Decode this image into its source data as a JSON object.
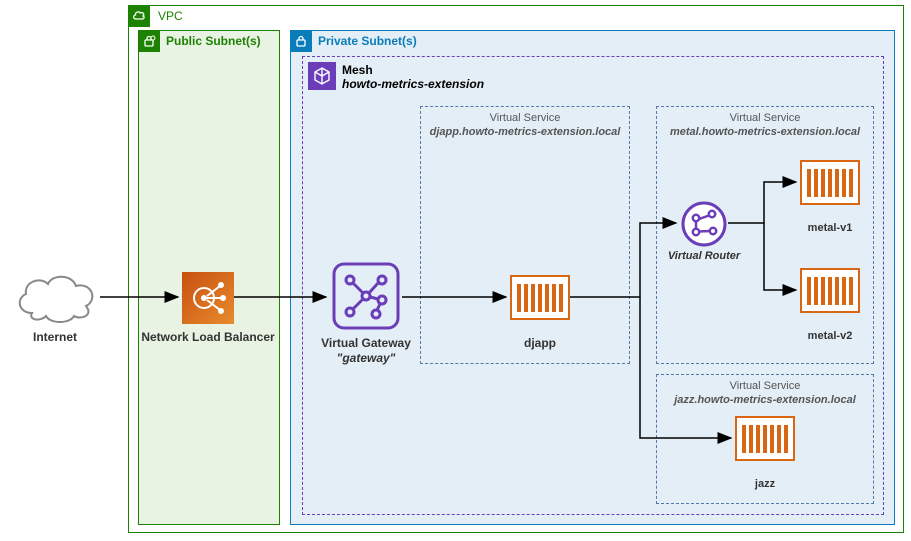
{
  "internet": {
    "label": "Internet"
  },
  "vpc": {
    "label": "VPC"
  },
  "public_subnet": {
    "label": "Public Subnet(s)"
  },
  "private_subnet": {
    "label": "Private Subnet(s)"
  },
  "nlb": {
    "label": "Network Load Balancer"
  },
  "mesh": {
    "title": "Mesh",
    "subtitle": "howto-metrics-extension"
  },
  "virtual_gateway": {
    "title": "Virtual Gateway",
    "subtitle": "\"gateway\""
  },
  "vs_djapp": {
    "title": "Virtual Service",
    "subtitle": "djapp.howto-metrics-extension.local",
    "node_label": "djapp"
  },
  "virtual_router": {
    "label": "Virtual Router"
  },
  "vs_metal": {
    "title": "Virtual Service",
    "subtitle": "metal.howto-metrics-extension.local",
    "node1": "metal-v1",
    "node2": "metal-v2"
  },
  "vs_jazz": {
    "title": "Virtual Service",
    "subtitle": "jazz.howto-metrics-extension.local",
    "node_label": "jazz"
  },
  "colors": {
    "vpc_border": "#1d8102",
    "public_border": "#1d8102",
    "public_fill": "#e8f3e3",
    "private_border": "#0b7cba",
    "private_fill": "#e3eef6",
    "mesh_border": "#6b3db8",
    "nlb_fill": "#d86613",
    "container_border": "#d86613",
    "vs_border": "#5577aa"
  }
}
